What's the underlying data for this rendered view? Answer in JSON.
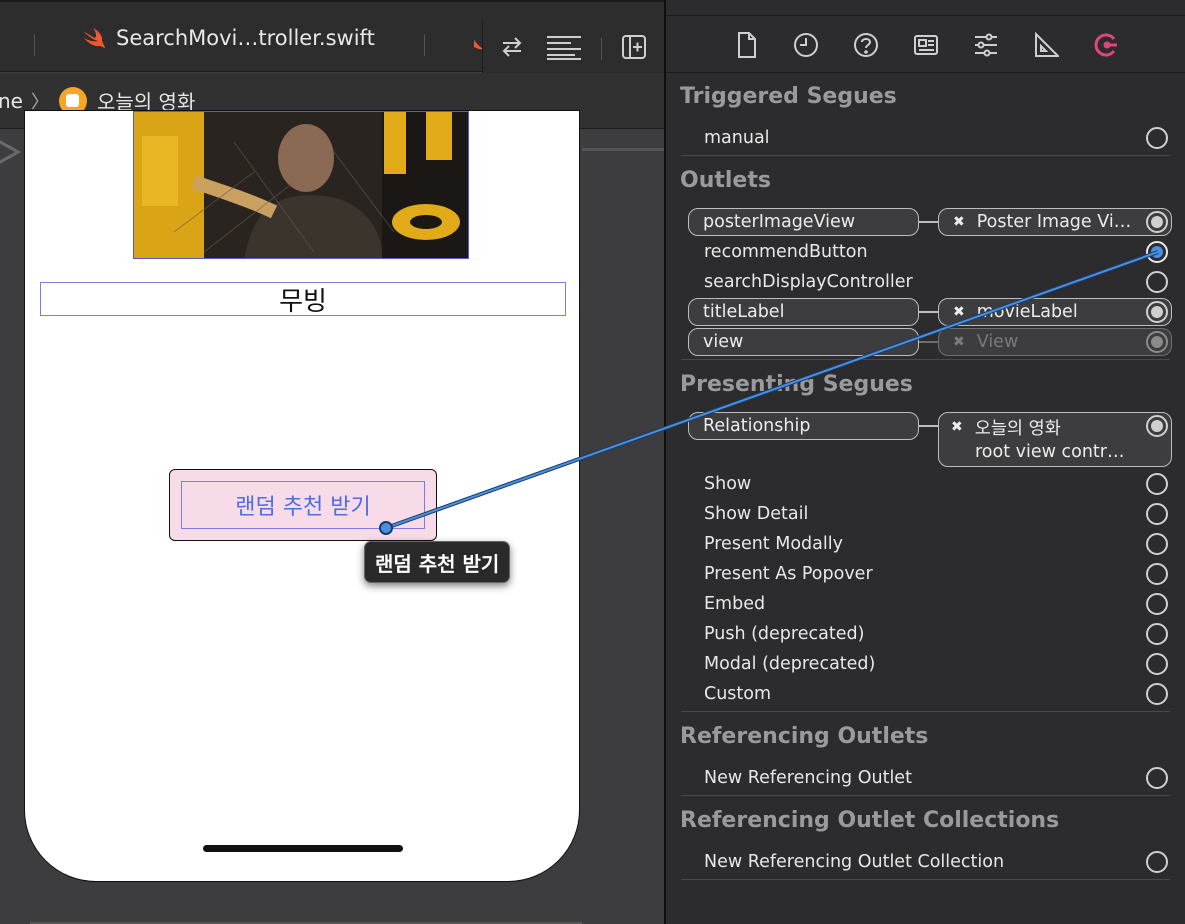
{
  "editor": {
    "tab_title": "SearchMovi…troller.swift",
    "jump_left": "ne",
    "jump_scene": "오늘의 영화"
  },
  "scene": {
    "title_label": "무빙",
    "recommend_button": "랜덤 추천 받기",
    "tooltip": "랜덤 추천 받기"
  },
  "inspector": {
    "tabs": [
      "file-icon",
      "history-icon",
      "help-icon",
      "identity-icon",
      "attributes-icon",
      "size-icon",
      "connections-icon"
    ],
    "triggered_segues": {
      "title": "Triggered Segues",
      "items": [
        "manual"
      ]
    },
    "outlets": {
      "title": "Outlets",
      "poster_outlet": "posterImageView",
      "poster_target": "Poster Image Vi…",
      "recommend_outlet": "recommendButton",
      "search_outlet": "searchDisplayController",
      "title_outlet": "titleLabel",
      "title_target": "movieLabel",
      "view_outlet": "view",
      "view_target": "View"
    },
    "presenting_segues": {
      "title": "Presenting Segues",
      "relationship": "Relationship",
      "relationship_target_1": "오늘의 영화",
      "relationship_target_2": "root view contr…",
      "items": [
        "Show",
        "Show Detail",
        "Present Modally",
        "Present As Popover",
        "Embed",
        "Push (deprecated)",
        "Modal (deprecated)",
        "Custom"
      ]
    },
    "referencing_outlets": {
      "title": "Referencing Outlets",
      "item": "New Referencing Outlet"
    },
    "referencing_collections": {
      "title": "Referencing Outlet Collections",
      "item": "New Referencing Outlet Collection"
    },
    "accent_color": "#4a90e2",
    "connections_tab_color": "#e0457b"
  }
}
